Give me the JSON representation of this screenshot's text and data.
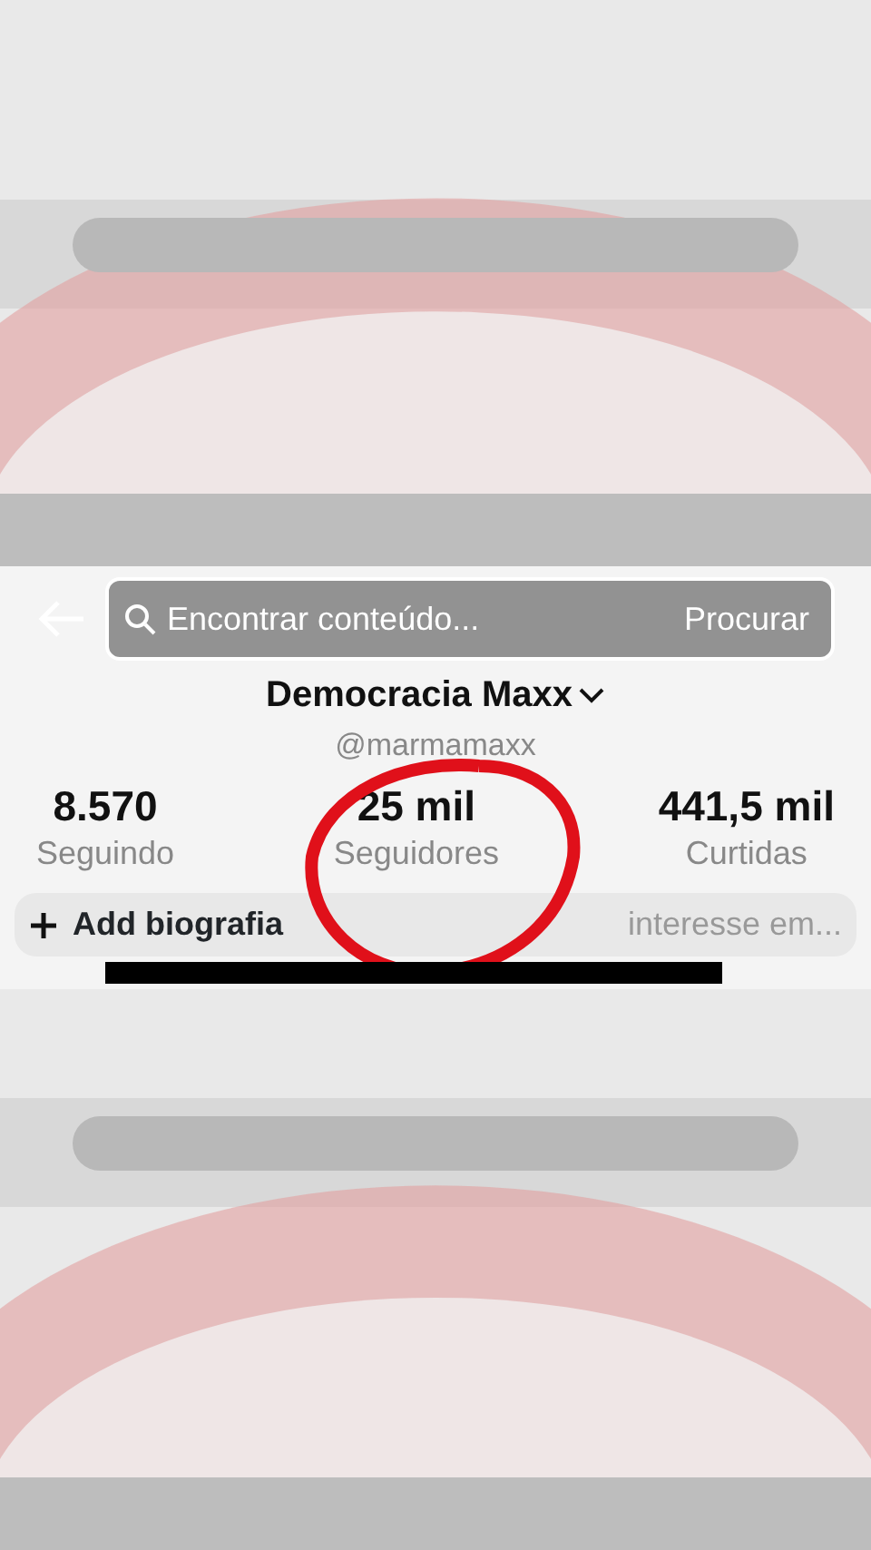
{
  "search_bar": {
    "placeholder": "Encontrar conteúdo...",
    "button": "Procurar"
  },
  "profile": {
    "name": "Democracia Maxx",
    "handle": "@marmamaxx"
  },
  "stats": [
    {
      "value": "8.570",
      "label": "Seguindo"
    },
    {
      "value": "25 mil",
      "label": "Seguidores"
    },
    {
      "value": "441,5 mil",
      "label": "Curtidas"
    }
  ],
  "bio": {
    "add_label": "Add biografia",
    "interests": "interesse em..."
  }
}
